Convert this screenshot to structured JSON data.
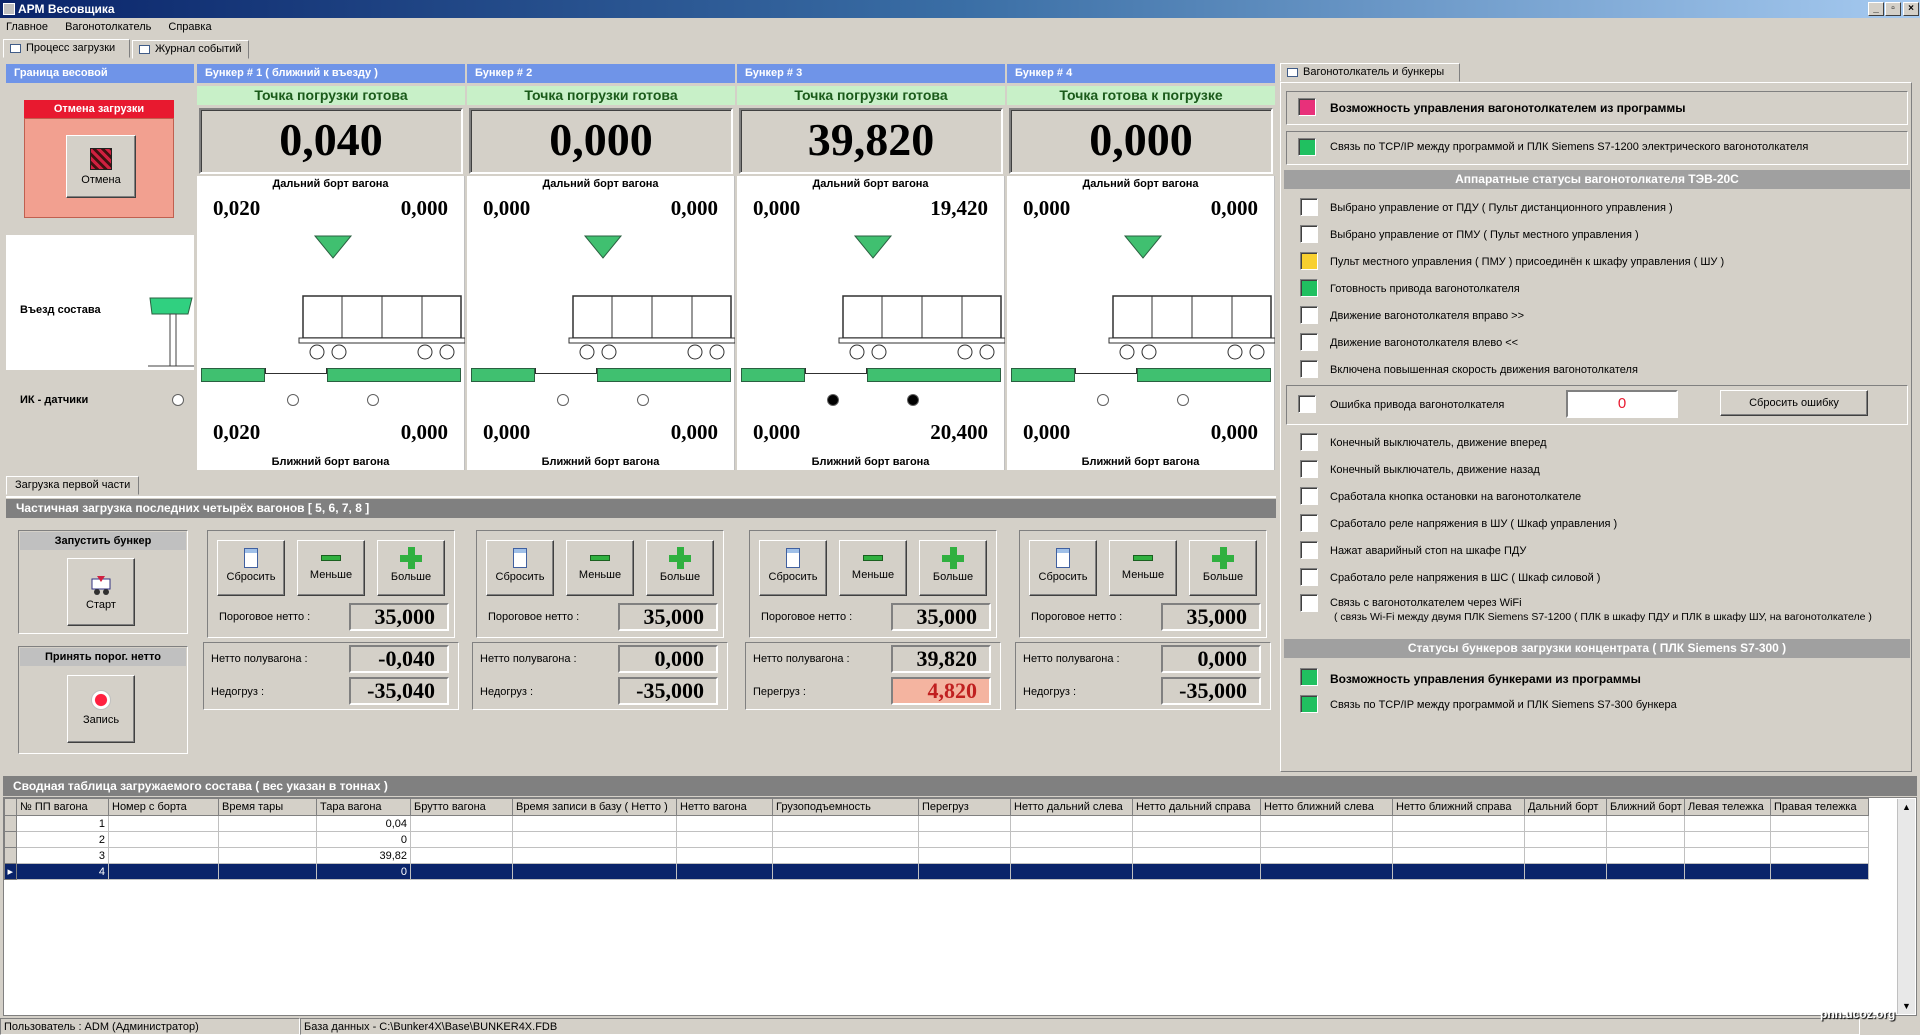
{
  "window": {
    "title": "АРМ Весовщика"
  },
  "menu": [
    "Главное",
    "Вагонотолкатель",
    "Справка"
  ],
  "tabs": {
    "process": "Процесс загрузки",
    "journal": "Журнал событий"
  },
  "left": {
    "head": "Граница весовой",
    "cancel_head": "Отмена загрузки",
    "cancel_btn": "Отмена",
    "entry": "Въезд состава",
    "ik": "ИК - датчики"
  },
  "bunkers": [
    {
      "head": "Бункер # 1 ( ближний к въезду )",
      "status": "Точка погрузки готова",
      "weight": "0,040",
      "far_label": "Дальний борт вагона",
      "far_left": "0,020",
      "far_right": "0,000",
      "near_left": "0,020",
      "near_right": "0,000",
      "near_label": "Ближний борт вагона",
      "s1": false,
      "s2": false
    },
    {
      "head": "Бункер # 2",
      "status": "Точка погрузки готова",
      "weight": "0,000",
      "far_label": "Дальний борт вагона",
      "far_left": "0,000",
      "far_right": "0,000",
      "near_left": "0,000",
      "near_right": "0,000",
      "near_label": "Ближний борт вагона",
      "s1": false,
      "s2": false
    },
    {
      "head": "Бункер # 3",
      "status": "Точка погрузки готова",
      "weight": "39,820",
      "far_label": "Дальний борт вагона",
      "far_left": "0,000",
      "far_right": "19,420",
      "near_left": "0,000",
      "near_right": "20,400",
      "near_label": "Ближний борт вагона",
      "s1": true,
      "s2": true
    },
    {
      "head": "Бункер # 4",
      "status": "Точка готова к погрузке",
      "weight": "0,000",
      "far_label": "Дальний борт вагона",
      "far_left": "0,000",
      "far_right": "0,000",
      "near_left": "0,000",
      "near_right": "0,000",
      "near_label": "Ближний борт вагона",
      "s1": false,
      "s2": false
    }
  ],
  "partial": {
    "tab": "Загрузка первой части",
    "head": "Частичная загрузка последних четырёх вагонов  [ 5, 6, 7, 8 ]",
    "start_head": "Запустить бункер",
    "start_btn": "Старт",
    "accept_head": "Принять порог. нетто",
    "record_btn": "Запись"
  },
  "controls": [
    {
      "reset": "Сбросить",
      "less": "Меньше",
      "more": "Больше",
      "thr_label": "Пороговое нетто :",
      "thr": "35,000",
      "net_label": "Нетто полувагона :",
      "net": "-0,040",
      "diff_label": "Недогруз :",
      "diff": "-35,040",
      "over": false
    },
    {
      "reset": "Сбросить",
      "less": "Меньше",
      "more": "Больше",
      "thr_label": "Пороговое нетто :",
      "thr": "35,000",
      "net_label": "Нетто полувагона :",
      "net": "0,000",
      "diff_label": "Недогруз :",
      "diff": "-35,000",
      "over": false
    },
    {
      "reset": "Сбросить",
      "less": "Меньше",
      "more": "Больше",
      "thr_label": "Пороговое нетто :",
      "thr": "35,000",
      "net_label": "Нетто полувагона :",
      "net": "39,820",
      "diff_label": "Перегруз :",
      "diff": "4,820",
      "over": true
    },
    {
      "reset": "Сбросить",
      "less": "Меньше",
      "more": "Больше",
      "thr_label": "Пороговое нетто :",
      "thr": "35,000",
      "net_label": "Нетто полувагона :",
      "net": "0,000",
      "diff_label": "Недогруз :",
      "diff": "-35,000",
      "over": false
    }
  ],
  "right": {
    "tab": "Вагонотолкатель и бункеры",
    "top": [
      {
        "text": "Возможность управления вагонотолкателем из программы",
        "color": "#e8307a",
        "bold": true
      },
      {
        "text": "Связь по TCP/IP между программой и ПЛК Siemens S7-1200 электрического вагонотолкателя",
        "color": "#20c060",
        "bold": false
      }
    ],
    "hw_head": "Аппаратные  статусы  вагонотолкателя  ТЭВ-20С",
    "hw": [
      {
        "text": "Выбрано управление от ПДУ  ( Пульт дистанционного управления )",
        "color": "#ffffff"
      },
      {
        "text": "Выбрано управление от ПМУ  ( Пульт местного управления )",
        "color": "#ffffff"
      },
      {
        "text": "Пульт местного управления ( ПМУ ) присоединён к шкафу управления  ( ШУ )",
        "color": "#f8d030"
      },
      {
        "text": "Готовность привода вагонотолкателя",
        "color": "#20c060"
      },
      {
        "text": "Движение вагонотолкателя вправо   >>",
        "color": "#ffffff"
      },
      {
        "text": "Движение вагонотолкателя влево    <<",
        "color": "#ffffff"
      },
      {
        "text": "Включена повышенная скорость движения вагонотолкателя",
        "color": "#ffffff"
      }
    ],
    "error_label": "Ошибка привода вагонотолкателя",
    "error_value": "0",
    "reset_error": "Сбросить ошибку",
    "hw2": [
      {
        "text": " Конечный выключатель, движение вперед",
        "color": "#ffffff"
      },
      {
        "text": "Конечный выключатель, движение назад",
        "color": "#ffffff"
      },
      {
        "text": "Сработала кнопка остановки на вагонотолкателе",
        "color": "#ffffff"
      },
      {
        "text": "Сработало реле напряжения в ШУ  ( Шкаф управления )",
        "color": "#ffffff"
      },
      {
        "text": "Нажат аварийный стоп на шкафе ПДУ",
        "color": "#ffffff"
      },
      {
        "text": "Сработало реле напряжения в ШС  ( Шкаф силовой )",
        "color": "#ffffff"
      }
    ],
    "wifi_line1": "Связь с вагонотолкателем через WiFi",
    "wifi_line2": "( связь Wi-Fi между двумя ПЛК Siemens S7-1200   ( ПЛК в шкафу ПДУ и ПЛК в шкафу ШУ, на вагонотолкателе )",
    "bunk_head": "Статусы  бункеров загрузки концентрата  ( ПЛК Siemens S7-300 )",
    "bunk": [
      {
        "text": "Возможность управления бункерами из программы",
        "color": "#20c060",
        "bold": true
      },
      {
        "text": "Связь по TCP/IP между программой и ПЛК Siemens S7-300 бункера",
        "color": "#20c060",
        "bold": false
      }
    ]
  },
  "summary": {
    "head": "Сводная таблица загружаемого состава  ( вес указан в тоннах )",
    "columns": [
      "№ ПП вагона",
      "Номер с борта",
      "Время тары",
      "Тара вагона",
      "Брутто вагона",
      "Время записи в базу ( Нетто )",
      "Нетто вагона",
      "Грузоподъемность",
      "Перегруз",
      "Нетто дальний слева",
      "Нетто дальний справа",
      "Нетто ближний слева",
      "Нетто ближний справа",
      "Дальний борт",
      "Ближний борт",
      "Левая тележка",
      "Правая тележка"
    ],
    "rows": [
      {
        "n": "1",
        "tara": "0,04",
        "sel": false
      },
      {
        "n": "2",
        "tara": "0",
        "sel": false
      },
      {
        "n": "3",
        "tara": "39,82",
        "sel": false
      },
      {
        "n": "4",
        "tara": "0",
        "sel": true
      }
    ]
  },
  "status": {
    "user": "Пользователь : ADM (Администратор)",
    "db": "База данных - C:\\Bunker4X\\Base\\BUNKER4X.FDB",
    "watermark": "pnn.ucoz.org"
  }
}
